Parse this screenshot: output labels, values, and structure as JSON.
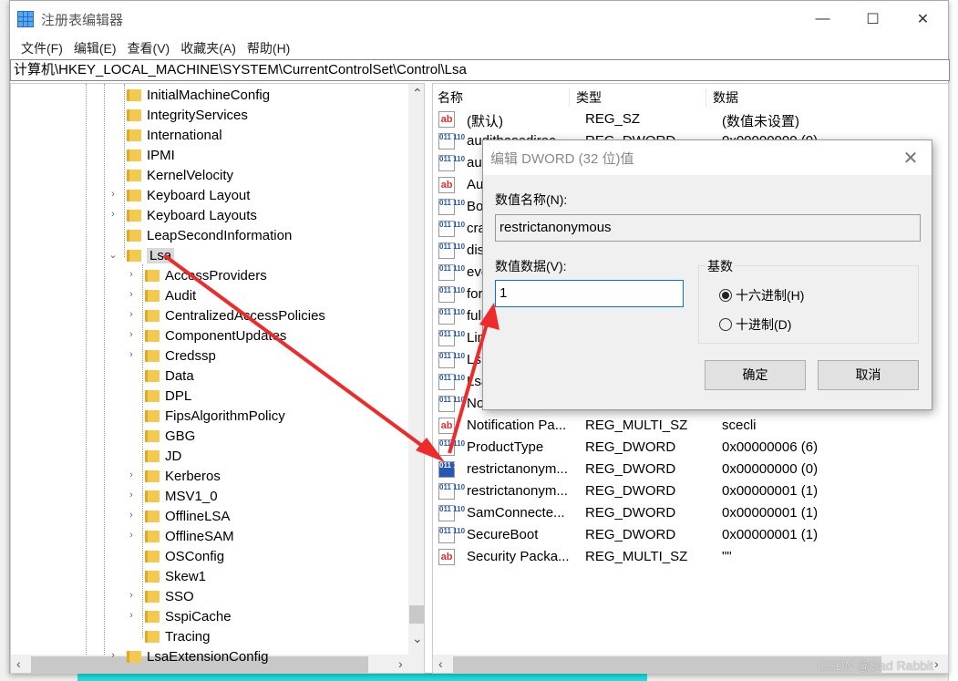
{
  "window": {
    "title": "注册表编辑器",
    "controls": [
      "—",
      "☐",
      "✕"
    ]
  },
  "menu": [
    "文件(F)",
    "编辑(E)",
    "查看(V)",
    "收藏夹(A)",
    "帮助(H)"
  ],
  "address": "计算机\\HKEY_LOCAL_MACHINE\\SYSTEM\\CurrentControlSet\\Control\\Lsa",
  "tree": [
    {
      "label": "InitialMachineConfig",
      "level": 1,
      "expander": false
    },
    {
      "label": "IntegrityServices",
      "level": 1,
      "expander": false
    },
    {
      "label": "International",
      "level": 1,
      "expander": false
    },
    {
      "label": "IPMI",
      "level": 1,
      "expander": false
    },
    {
      "label": "KernelVelocity",
      "level": 1,
      "expander": false
    },
    {
      "label": "Keyboard Layout",
      "level": 1,
      "expander": true
    },
    {
      "label": "Keyboard Layouts",
      "level": 1,
      "expander": true
    },
    {
      "label": "LeapSecondInformation",
      "level": 1,
      "expander": false
    },
    {
      "label": "Lsa",
      "level": 1,
      "expander": "open",
      "selected": true
    },
    {
      "label": "AccessProviders",
      "level": 2,
      "expander": true
    },
    {
      "label": "Audit",
      "level": 2,
      "expander": true
    },
    {
      "label": "CentralizedAccessPolicies",
      "level": 2,
      "expander": true
    },
    {
      "label": "ComponentUpdates",
      "level": 2,
      "expander": true
    },
    {
      "label": "Credssp",
      "level": 2,
      "expander": true
    },
    {
      "label": "Data",
      "level": 2,
      "expander": false
    },
    {
      "label": "DPL",
      "level": 2,
      "expander": false
    },
    {
      "label": "FipsAlgorithmPolicy",
      "level": 2,
      "expander": false
    },
    {
      "label": "GBG",
      "level": 2,
      "expander": false
    },
    {
      "label": "JD",
      "level": 2,
      "expander": false
    },
    {
      "label": "Kerberos",
      "level": 2,
      "expander": true
    },
    {
      "label": "MSV1_0",
      "level": 2,
      "expander": true
    },
    {
      "label": "OfflineLSA",
      "level": 2,
      "expander": true
    },
    {
      "label": "OfflineSAM",
      "level": 2,
      "expander": true
    },
    {
      "label": "OSConfig",
      "level": 2,
      "expander": false
    },
    {
      "label": "Skew1",
      "level": 2,
      "expander": false
    },
    {
      "label": "SSO",
      "level": 2,
      "expander": true
    },
    {
      "label": "SspiCache",
      "level": 2,
      "expander": true
    },
    {
      "label": "Tracing",
      "level": 2,
      "expander": false
    },
    {
      "label": "LsaExtensionConfig",
      "level": 1,
      "expander": true
    }
  ],
  "list": {
    "headers": [
      "名称",
      "类型",
      "数据"
    ],
    "rows": [
      {
        "icon": "sz",
        "name": "(默认)",
        "type": "REG_SZ",
        "data": "(数值未设置)"
      },
      {
        "icon": "dw",
        "name": "auditbasedirec...",
        "type": "REG_DWORD",
        "data": "0x00000000 (0)"
      },
      {
        "icon": "dw",
        "name": "audi",
        "type": "",
        "data": ""
      },
      {
        "icon": "sz",
        "name": "Auth",
        "type": "",
        "data": ""
      },
      {
        "icon": "dw",
        "name": "Bou",
        "type": "",
        "data": ""
      },
      {
        "icon": "dw",
        "name": "cras",
        "type": "",
        "data": ""
      },
      {
        "icon": "dw",
        "name": "disa",
        "type": "",
        "data": ""
      },
      {
        "icon": "dw",
        "name": "ever",
        "type": "",
        "data": ""
      },
      {
        "icon": "dw",
        "name": "forc",
        "type": "",
        "data": ""
      },
      {
        "icon": "dw",
        "name": "fullp",
        "type": "",
        "data": ""
      },
      {
        "icon": "dw",
        "name": "Lim",
        "type": "",
        "data": ""
      },
      {
        "icon": "dw",
        "name": "Ls",
        "type": "",
        "data": ""
      },
      {
        "icon": "dw",
        "name": "LsaP",
        "type": "",
        "data": ""
      },
      {
        "icon": "dw",
        "name": "NoL",
        "type": "",
        "data": ""
      },
      {
        "icon": "sz",
        "name": "Notification Pa...",
        "type": "REG_MULTI_SZ",
        "data": "scecli"
      },
      {
        "icon": "dw",
        "name": "ProductType",
        "type": "REG_DWORD",
        "data": "0x00000006 (6)"
      },
      {
        "icon": "sel",
        "name": "restrictanonym...",
        "type": "REG_DWORD",
        "data": "0x00000000 (0)"
      },
      {
        "icon": "dw",
        "name": "restrictanonym...",
        "type": "REG_DWORD",
        "data": "0x00000001 (1)"
      },
      {
        "icon": "dw",
        "name": "SamConnecte...",
        "type": "REG_DWORD",
        "data": "0x00000001 (1)"
      },
      {
        "icon": "dw",
        "name": "SecureBoot",
        "type": "REG_DWORD",
        "data": "0x00000001 (1)"
      },
      {
        "icon": "sz",
        "name": "Security Packa...",
        "type": "REG_MULTI_SZ",
        "data": "\"\""
      }
    ]
  },
  "dialog": {
    "title": "编辑 DWORD (32 位)值",
    "name_label": "数值名称(N):",
    "name_value": "restrictanonymous",
    "data_label": "数值数据(V):",
    "data_value": "1",
    "base_label": "基数",
    "hex_label": "十六进制(H)",
    "dec_label": "十进制(D)",
    "base_selected": "hex",
    "ok": "确定",
    "cancel": "取消",
    "close": "✕"
  },
  "annotation_color": "#ee2a2a",
  "watermark": "CSDN @Sad Rabbit"
}
